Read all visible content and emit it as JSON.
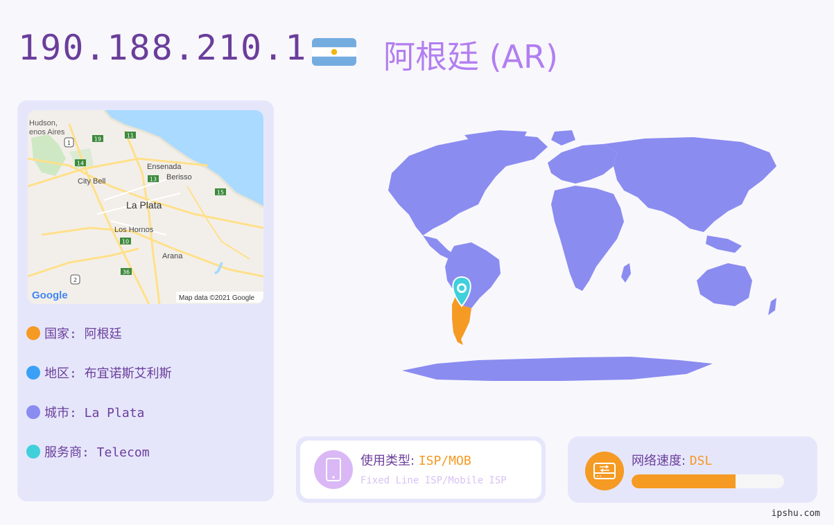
{
  "header": {
    "ip": "190.188.210.1",
    "country_title": "阿根廷 (AR)",
    "flag_colors": [
      "#74acdf",
      "#ffffff",
      "#74acdf"
    ],
    "sun_color": "#f6b40e"
  },
  "map": {
    "labels": {
      "hudson": "Hudson,",
      "buenos_aires": "enos Aires",
      "ensenada": "Ensenada",
      "berisso": "Berisso",
      "city_bell": "City Bell",
      "la_plata": "La Plata",
      "los_hornos": "Los Hornos",
      "arana": "Arana",
      "google": "Google",
      "attribution": "Map data ©2021 Google"
    },
    "route_shields": [
      "19",
      "11",
      "1",
      "14",
      "13",
      "15",
      "10",
      "36",
      "2"
    ]
  },
  "info": {
    "country": "国家: 阿根廷",
    "region": "地区: 布宜诺斯艾利斯",
    "city": "城市: La Plata",
    "isp": "服务商: Telecom",
    "colors": {
      "country": "#f59a23",
      "region": "#3aa0f5",
      "city": "#8a8cf0",
      "isp": "#3fd0dc"
    }
  },
  "usage": {
    "label": "使用类型: ",
    "value": "ISP/MOB",
    "sub": "Fixed Line ISP/Mobile ISP",
    "icon": "mobile-phone-icon"
  },
  "speed": {
    "label": "网络速度: ",
    "value": "DSL",
    "fill_fraction": 0.68,
    "icon": "network-drive-icon"
  },
  "footer": {
    "site": "ipshu.com"
  },
  "colors": {
    "accent_purple": "#6a3e9a",
    "light_purple": "#b27ef0",
    "orange": "#f59a23",
    "world_fill": "#8a8cf0",
    "pin": "#3fd0dc"
  }
}
